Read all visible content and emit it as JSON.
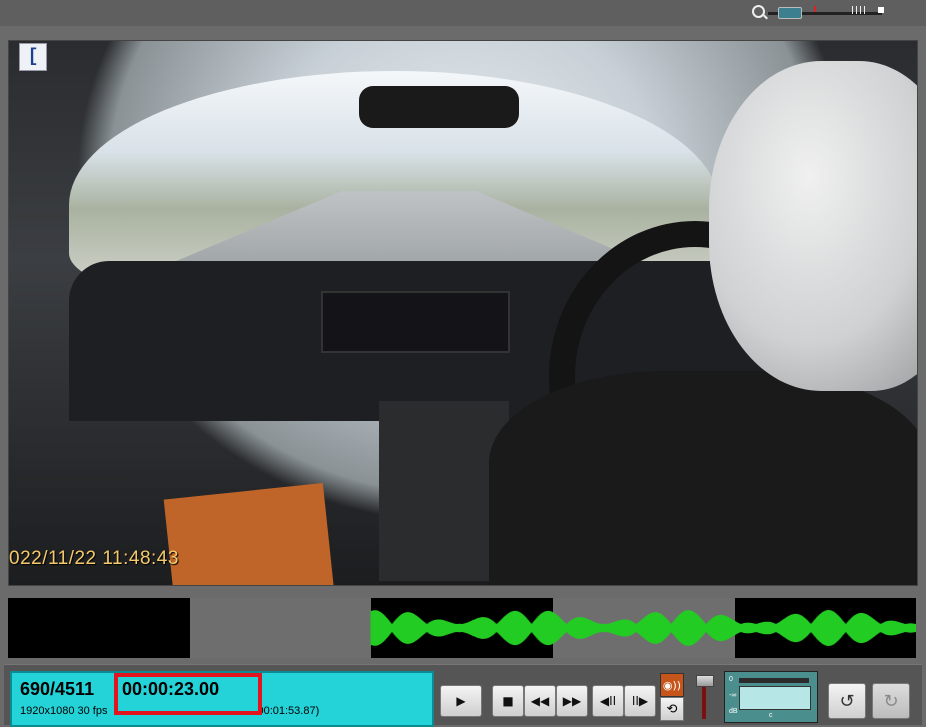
{
  "video": {
    "timestamp_overlay": "022/11/22  11:48:43",
    "corner_glyph": "["
  },
  "waveform": {
    "color": "#22cc22"
  },
  "info_panel": {
    "frame_counter": "690/4511",
    "current_time": "00:00:23.00",
    "meta": "1920x1080 30 fps",
    "meta_partial": "00:01:53.87)"
  },
  "controls": {
    "play": "▶",
    "stop": "■",
    "rewind": "◀◀",
    "fast_forward": "▶▶",
    "step_back": "◀II",
    "step_forward": "II▶",
    "audio": "◉))",
    "loop": "⟲",
    "undo": "↺",
    "redo": "↻"
  },
  "meter": {
    "label_top": "0",
    "label_mid": "-∞",
    "label_bot": "dB",
    "label_c": "c"
  }
}
